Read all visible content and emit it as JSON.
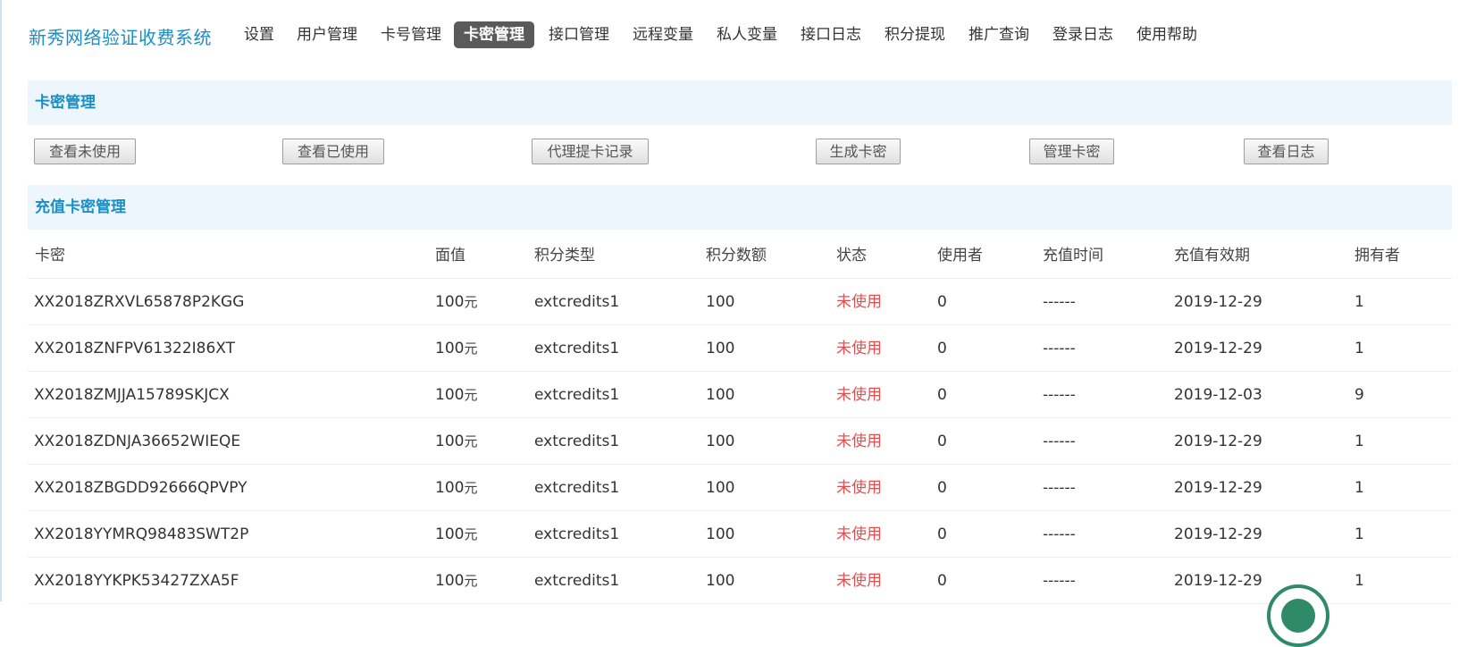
{
  "brand": "新秀网络验证收费系统",
  "nav": [
    {
      "label": "设置",
      "active": false
    },
    {
      "label": "用户管理",
      "active": false
    },
    {
      "label": "卡号管理",
      "active": false
    },
    {
      "label": "卡密管理",
      "active": true
    },
    {
      "label": "接口管理",
      "active": false
    },
    {
      "label": "远程变量",
      "active": false
    },
    {
      "label": "私人变量",
      "active": false
    },
    {
      "label": "接口日志",
      "active": false
    },
    {
      "label": "积分提现",
      "active": false
    },
    {
      "label": "推广查询",
      "active": false
    },
    {
      "label": "登录日志",
      "active": false
    },
    {
      "label": "使用帮助",
      "active": false
    }
  ],
  "section1": {
    "title": "卡密管理"
  },
  "buttons": [
    "查看未使用",
    "查看已使用",
    "代理提卡记录",
    "生成卡密",
    "管理卡密",
    "查看日志"
  ],
  "section2": {
    "title": "充值卡密管理"
  },
  "table": {
    "columns": [
      "卡密",
      "面值",
      "积分类型",
      "积分数额",
      "状态",
      "使用者",
      "充值时间",
      "充值有效期",
      "拥有者"
    ],
    "unit": "元",
    "rows": [
      {
        "card": "XX2018ZRXVL65878P2KGG",
        "value": "100",
        "credit_type": "extcredits1",
        "credit_amount": "100",
        "status": "未使用",
        "user": "0",
        "recharge_time": "------",
        "expiry": "2019-12-29",
        "owner": "1"
      },
      {
        "card": "XX2018ZNFPV61322I86XT",
        "value": "100",
        "credit_type": "extcredits1",
        "credit_amount": "100",
        "status": "未使用",
        "user": "0",
        "recharge_time": "------",
        "expiry": "2019-12-29",
        "owner": "1"
      },
      {
        "card": "XX2018ZMJJA15789SKJCX",
        "value": "100",
        "credit_type": "extcredits1",
        "credit_amount": "100",
        "status": "未使用",
        "user": "0",
        "recharge_time": "------",
        "expiry": "2019-12-03",
        "owner": "9"
      },
      {
        "card": "XX2018ZDNJA36652WIEQE",
        "value": "100",
        "credit_type": "extcredits1",
        "credit_amount": "100",
        "status": "未使用",
        "user": "0",
        "recharge_time": "------",
        "expiry": "2019-12-29",
        "owner": "1"
      },
      {
        "card": "XX2018ZBGDD92666QPVPY",
        "value": "100",
        "credit_type": "extcredits1",
        "credit_amount": "100",
        "status": "未使用",
        "user": "0",
        "recharge_time": "------",
        "expiry": "2019-12-29",
        "owner": "1"
      },
      {
        "card": "XX2018YYMRQ98483SWT2P",
        "value": "100",
        "credit_type": "extcredits1",
        "credit_amount": "100",
        "status": "未使用",
        "user": "0",
        "recharge_time": "------",
        "expiry": "2019-12-29",
        "owner": "1"
      },
      {
        "card": "XX2018YYKPK53427ZXA5F",
        "value": "100",
        "credit_type": "extcredits1",
        "credit_amount": "100",
        "status": "未使用",
        "user": "0",
        "recharge_time": "------",
        "expiry": "2019-12-29",
        "owner": "1"
      }
    ]
  },
  "colors": {
    "brand": "#1a8fc6",
    "active_nav_bg": "#5a5a5a",
    "section_bg": "#eef6fd",
    "status_unused": "#e05050"
  }
}
